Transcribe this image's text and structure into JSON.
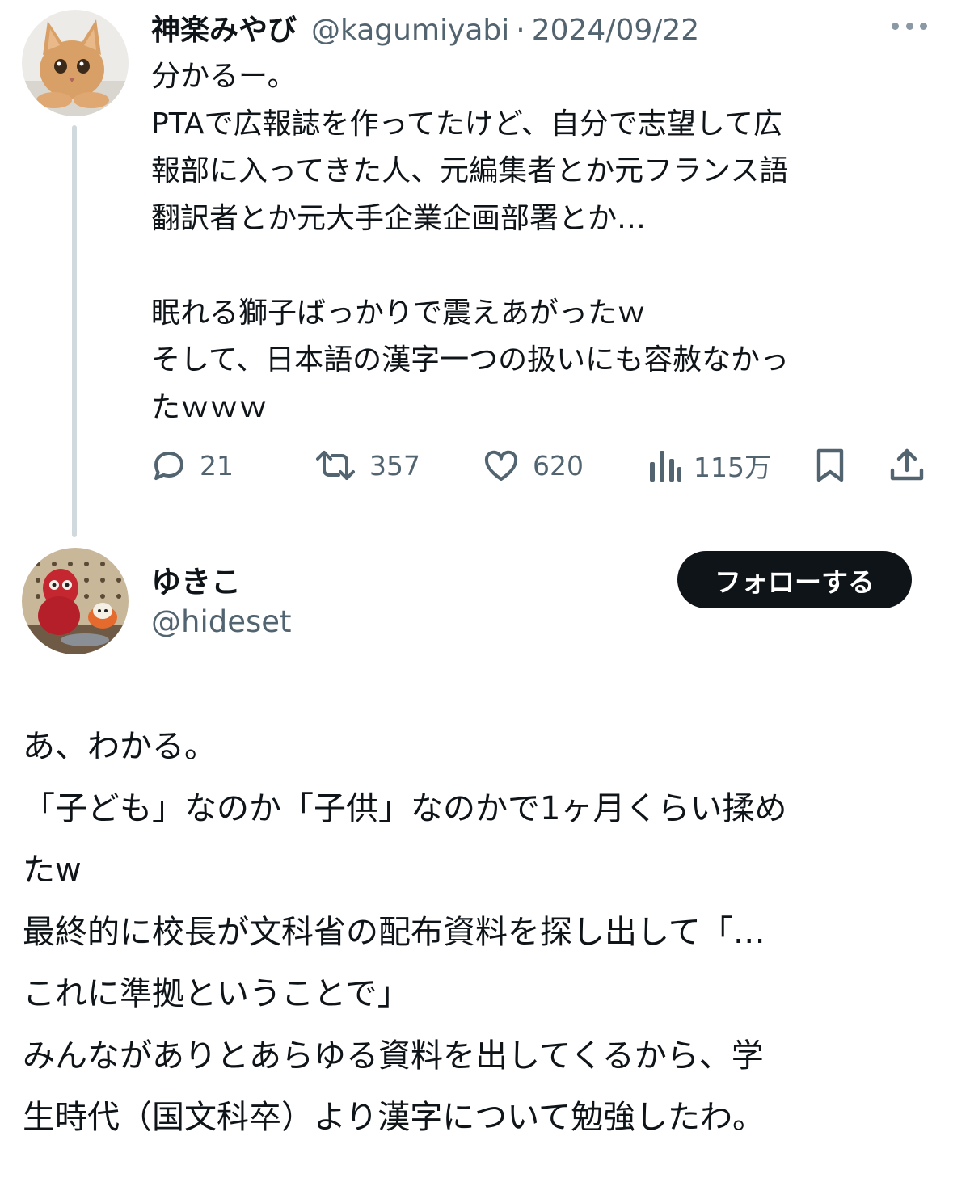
{
  "tweet1": {
    "name": "神楽みやび",
    "handle": "@kagumiyabi",
    "separator": "·",
    "date": "2024/09/22",
    "body": "分かるー。\nPTAで広報誌を作ってたけど、自分で志望して広\n報部に入ってきた人、元編集者とか元フランス語\n翻訳者とか元大手企業企画部署とか…\n\n眠れる獅子ばっかりで震えあがったｗ\nそして、日本語の漢字一つの扱いにも容赦なかっ\nたｗｗｗ",
    "actions": {
      "replies": "21",
      "retweets": "357",
      "likes": "620",
      "views": "115万"
    }
  },
  "tweet2": {
    "name": "ゆきこ",
    "handle": "@hideset",
    "follow_label": "フォローする",
    "body": "あ、わかる。\n「子ども」なのか「子供」なのかで1ヶ月くらい揉め\nたw\n最終的に校長が文科省の配布資料を探し出して「…\nこれに準拠ということで」\nみんながありとあらゆる資料を出してくるから、学\n生時代（国文科卒）より漢字について勉強したわ。"
  },
  "icons": {
    "more": "more-horizontal-icon",
    "reply": "reply-bubble-icon",
    "retweet": "retweet-icon",
    "like": "heart-icon",
    "views": "views-chart-icon",
    "bookmark": "bookmark-icon",
    "share": "share-upload-icon"
  },
  "colors": {
    "text_primary": "#0f1419",
    "text_secondary": "#536471",
    "thread_line": "#cfd9de",
    "follow_button_bg": "#0f1419",
    "follow_button_text": "#ffffff"
  }
}
